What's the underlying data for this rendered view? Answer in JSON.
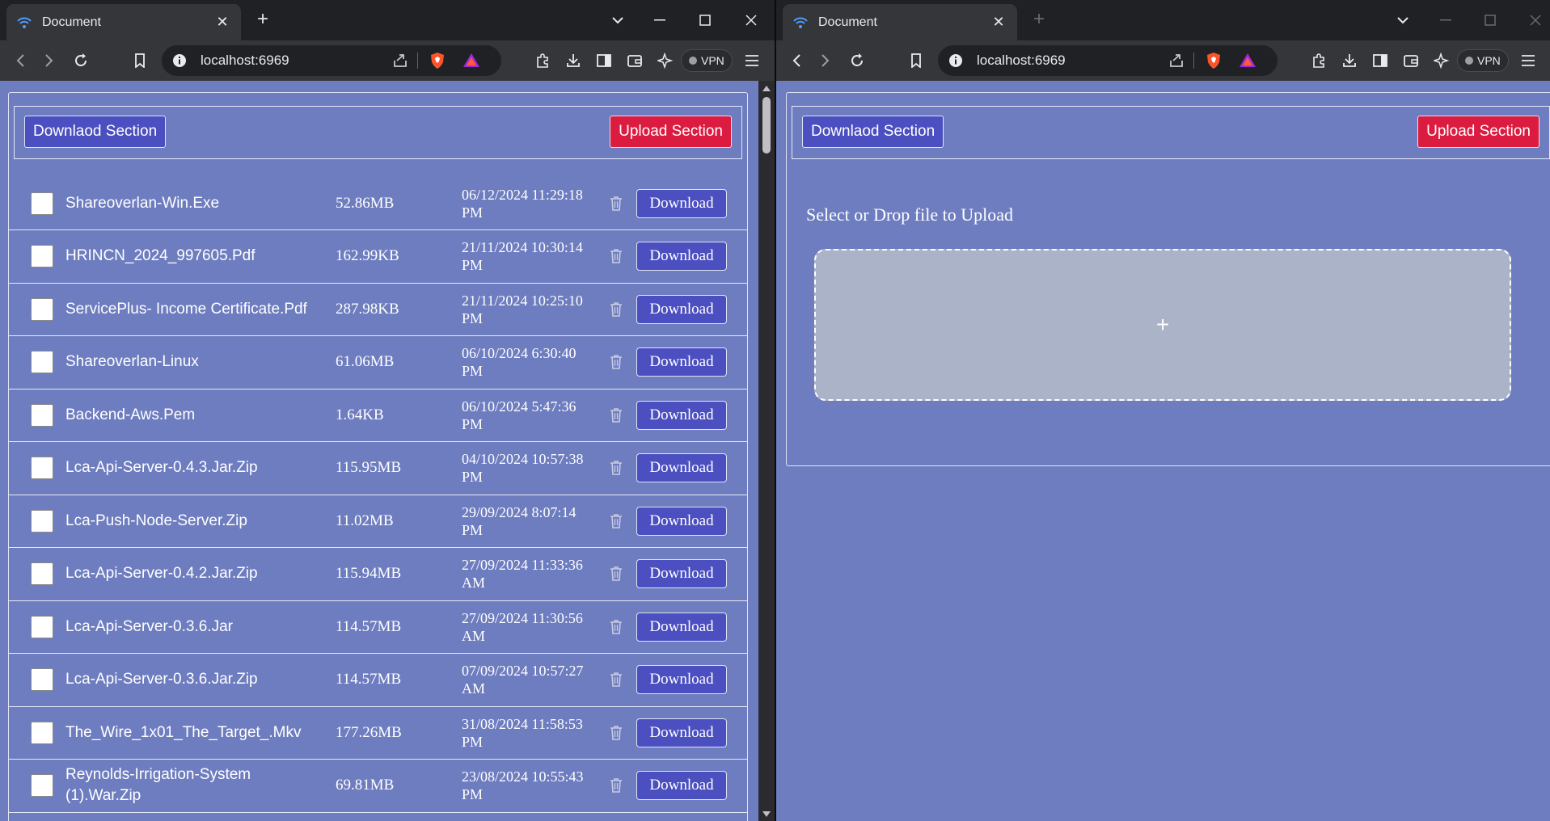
{
  "browser": {
    "tab_title": "Document",
    "url": "localhost:6969",
    "vpn_label": "VPN",
    "new_tab_glyph": "+",
    "close_tab_glyph": "✕"
  },
  "app": {
    "download_section_label": "Downlaod Section",
    "upload_section_label": "Upload Section",
    "download_button_label": "Download",
    "colors": {
      "page_bg": "#6e7dbf",
      "download_section_bg": "#4c4fc0",
      "upload_section_bg": "#dc1b40",
      "dropzone_bg": "#aab3c7"
    }
  },
  "files": [
    {
      "name": "Shareoverlan-Win.Exe",
      "size": "52.86MB",
      "date_line1": "06/12/2024 11:29:18",
      "date_line2": "PM"
    },
    {
      "name": "HRINCN_2024_997605.Pdf",
      "size": "162.99KB",
      "date_line1": "21/11/2024 10:30:14",
      "date_line2": "PM"
    },
    {
      "name": "ServicePlus- Income Certificate.Pdf",
      "size": "287.98KB",
      "date_line1": "21/11/2024 10:25:10",
      "date_line2": "PM"
    },
    {
      "name": "Shareoverlan-Linux",
      "size": "61.06MB",
      "date_line1": "06/10/2024 6:30:40",
      "date_line2": "PM"
    },
    {
      "name": "Backend-Aws.Pem",
      "size": "1.64KB",
      "date_line1": "06/10/2024 5:47:36",
      "date_line2": "PM"
    },
    {
      "name": "Lca-Api-Server-0.4.3.Jar.Zip",
      "size": "115.95MB",
      "date_line1": "04/10/2024 10:57:38",
      "date_line2": "PM"
    },
    {
      "name": "Lca-Push-Node-Server.Zip",
      "size": "11.02MB",
      "date_line1": "29/09/2024 8:07:14",
      "date_line2": "PM"
    },
    {
      "name": "Lca-Api-Server-0.4.2.Jar.Zip",
      "size": "115.94MB",
      "date_line1": "27/09/2024 11:33:36",
      "date_line2": "AM"
    },
    {
      "name": "Lca-Api-Server-0.3.6.Jar",
      "size": "114.57MB",
      "date_line1": "27/09/2024 11:30:56",
      "date_line2": "AM"
    },
    {
      "name": "Lca-Api-Server-0.3.6.Jar.Zip",
      "size": "114.57MB",
      "date_line1": "07/09/2024 10:57:27",
      "date_line2": "AM"
    },
    {
      "name": "The_Wire_1x01_The_Target_.Mkv",
      "size": "177.26MB",
      "date_line1": "31/08/2024 11:58:53",
      "date_line2": "PM"
    },
    {
      "name": "Reynolds-Irrigation-System (1).War.Zip",
      "size": "69.81MB",
      "date_line1": "23/08/2024 10:55:43",
      "date_line2": "PM"
    }
  ],
  "upload": {
    "prompt": "Select or Drop file to Upload",
    "plus_glyph": "+"
  }
}
